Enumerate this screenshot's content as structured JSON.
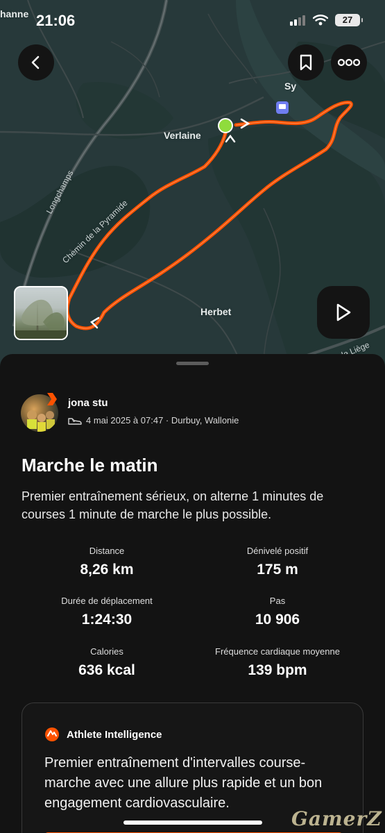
{
  "status_bar": {
    "time": "21:06",
    "battery": "27"
  },
  "map": {
    "labels": {
      "corner": "hanne",
      "sy": "Sy",
      "verlaine": "Verlaine",
      "herbet": "Herbet",
      "longchamps": "Longchamps",
      "chemin": "Chemin de la Pyramide",
      "liege": "e de Liège"
    },
    "route_color": "#fc5200",
    "start_color": "#8fdc3c"
  },
  "activity": {
    "athlete_name": "jona stu",
    "meta": "4 mai 2025 à 07:47 · Durbuy, Wallonie",
    "title": "Marche le matin",
    "description": "Premier entraînement sérieux, on alterne 1 minutes de courses 1 minute de marche le plus possible.",
    "stats": {
      "distance": {
        "label": "Distance",
        "value": "8,26 km"
      },
      "elevation": {
        "label": "Dénivelé positif",
        "value": "175 m"
      },
      "moving_time": {
        "label": "Durée de déplacement",
        "value": "1:24:30"
      },
      "steps": {
        "label": "Pas",
        "value": "10 906"
      },
      "calories": {
        "label": "Calories",
        "value": "636 kcal"
      },
      "heart_rate": {
        "label": "Fréquence cardiaque moyenne",
        "value": "139 bpm"
      }
    }
  },
  "athlete_intelligence": {
    "title": "Athlete Intelligence",
    "text": "Premier entraînement d'intervalles course-marche avec une allure plus rapide et un bon engagement cardiovasculaire."
  },
  "watermark": "GamerZ",
  "colors": {
    "accent": "#fc5200",
    "sheet_bg": "#131313",
    "map_bg": "#27393a"
  }
}
